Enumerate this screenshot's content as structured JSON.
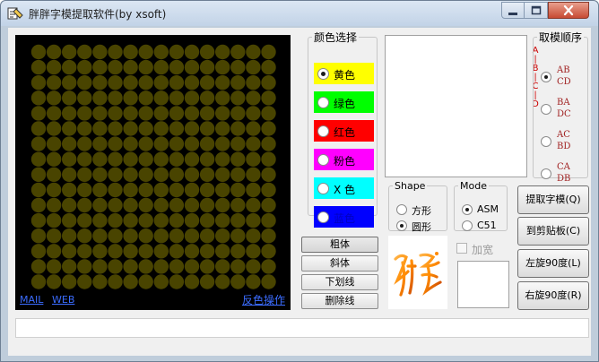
{
  "window": {
    "title": "胖胖字模提取软件(by xsoft)"
  },
  "matrix": {
    "rows": 16,
    "cols": 16,
    "dot_color": "#494400",
    "background": "#000000",
    "links": {
      "mail": "MAIL",
      "web": "WEB",
      "invert": "反色操作"
    }
  },
  "color_group": {
    "legend": "颜色选择",
    "options": [
      {
        "label": "黄色",
        "color": "#ffff00",
        "selected": true
      },
      {
        "label": "绿色",
        "color": "#00ff00",
        "selected": false
      },
      {
        "label": "红色",
        "color": "#ff0000",
        "selected": false
      },
      {
        "label": "粉色",
        "color": "#ff00ff",
        "selected": false
      },
      {
        "label": "X 色",
        "color": "#00ffff",
        "selected": false
      },
      {
        "label": "蓝色",
        "color": "#0000ff",
        "selected": false
      }
    ]
  },
  "order_group": {
    "legend": "取模顺序",
    "vertical_label": "A|B|C|D",
    "options": [
      {
        "line1": "AB",
        "line2": "CD",
        "selected": true
      },
      {
        "line1": "BA",
        "line2": "DC",
        "selected": false
      },
      {
        "line1": "AC",
        "line2": "BD",
        "selected": false
      },
      {
        "line1": "CA",
        "line2": "DB",
        "selected": false
      }
    ]
  },
  "shape_group": {
    "legend": "Shape",
    "options": [
      {
        "label": "方形",
        "selected": false
      },
      {
        "label": "圆形",
        "selected": true
      }
    ]
  },
  "mode_group": {
    "legend": "Mode",
    "options": [
      {
        "label": "ASM",
        "selected": true
      },
      {
        "label": "C51",
        "selected": false
      }
    ]
  },
  "font_style": {
    "bold": "粗体",
    "italic": "斜体",
    "underline": "下划线",
    "strikeout": "删除线"
  },
  "bold_check": {
    "label": "加宽",
    "checked": false,
    "enabled": false
  },
  "actions": {
    "extract": "提取字模(Q)",
    "clipboard": "到剪贴板(C)",
    "rotate_left": "左旋90度(L)",
    "rotate_right": "右旋90度(R)"
  },
  "status": {
    "text": ""
  }
}
